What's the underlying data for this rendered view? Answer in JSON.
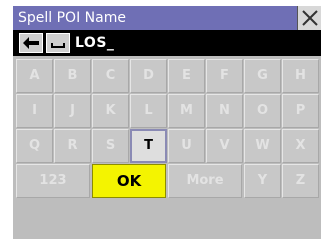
{
  "title": "Spell POI Name",
  "entry_text": "LOS_",
  "icons": {
    "close": "close-icon",
    "backspace": "backspace-arrow-icon",
    "space": "space-icon"
  },
  "colors": {
    "titlebar": "#6f6fb5",
    "ok_key": "#f4f400",
    "active_key_text": "#000000",
    "disabled_key_text": "#e3e3e3"
  },
  "keys": {
    "row1": [
      "A",
      "B",
      "C",
      "D",
      "E",
      "F",
      "G",
      "H"
    ],
    "row2": [
      "I",
      "J",
      "K",
      "L",
      "M",
      "N",
      "O",
      "P"
    ],
    "row3": [
      "Q",
      "R",
      "S",
      "T",
      "U",
      "V",
      "W",
      "X"
    ],
    "row4": {
      "numbers": "123",
      "ok": "OK",
      "more": "More",
      "y": "Y",
      "z": "Z"
    }
  },
  "enabled_keys": [
    "T",
    "OK"
  ]
}
